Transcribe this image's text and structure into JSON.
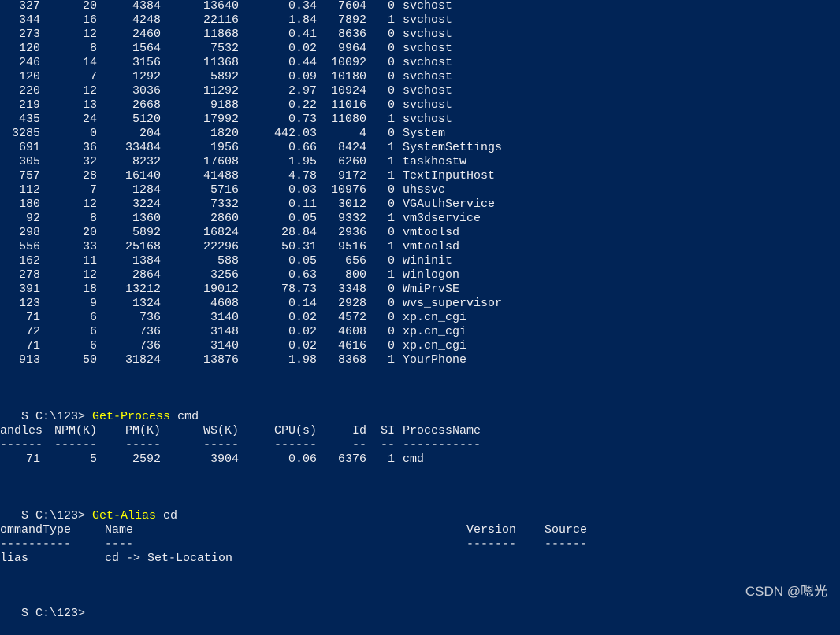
{
  "process_rows": [
    {
      "handles": "327",
      "npm": "20",
      "pm": "4384",
      "ws": "13640",
      "cpu": "0.34",
      "id": "7604",
      "si": "0",
      "name": "svchost"
    },
    {
      "handles": "344",
      "npm": "16",
      "pm": "4248",
      "ws": "22116",
      "cpu": "1.84",
      "id": "7892",
      "si": "1",
      "name": "svchost"
    },
    {
      "handles": "273",
      "npm": "12",
      "pm": "2460",
      "ws": "11868",
      "cpu": "0.41",
      "id": "8636",
      "si": "0",
      "name": "svchost"
    },
    {
      "handles": "120",
      "npm": "8",
      "pm": "1564",
      "ws": "7532",
      "cpu": "0.02",
      "id": "9964",
      "si": "0",
      "name": "svchost"
    },
    {
      "handles": "246",
      "npm": "14",
      "pm": "3156",
      "ws": "11368",
      "cpu": "0.44",
      "id": "10092",
      "si": "0",
      "name": "svchost"
    },
    {
      "handles": "120",
      "npm": "7",
      "pm": "1292",
      "ws": "5892",
      "cpu": "0.09",
      "id": "10180",
      "si": "0",
      "name": "svchost"
    },
    {
      "handles": "220",
      "npm": "12",
      "pm": "3036",
      "ws": "11292",
      "cpu": "2.97",
      "id": "10924",
      "si": "0",
      "name": "svchost"
    },
    {
      "handles": "219",
      "npm": "13",
      "pm": "2668",
      "ws": "9188",
      "cpu": "0.22",
      "id": "11016",
      "si": "0",
      "name": "svchost"
    },
    {
      "handles": "435",
      "npm": "24",
      "pm": "5120",
      "ws": "17992",
      "cpu": "0.73",
      "id": "11080",
      "si": "1",
      "name": "svchost"
    },
    {
      "handles": "3285",
      "npm": "0",
      "pm": "204",
      "ws": "1820",
      "cpu": "442.03",
      "id": "4",
      "si": "0",
      "name": "System"
    },
    {
      "handles": "691",
      "npm": "36",
      "pm": "33484",
      "ws": "1956",
      "cpu": "0.66",
      "id": "8424",
      "si": "1",
      "name": "SystemSettings"
    },
    {
      "handles": "305",
      "npm": "32",
      "pm": "8232",
      "ws": "17608",
      "cpu": "1.95",
      "id": "6260",
      "si": "1",
      "name": "taskhostw"
    },
    {
      "handles": "757",
      "npm": "28",
      "pm": "16140",
      "ws": "41488",
      "cpu": "4.78",
      "id": "9172",
      "si": "1",
      "name": "TextInputHost"
    },
    {
      "handles": "112",
      "npm": "7",
      "pm": "1284",
      "ws": "5716",
      "cpu": "0.03",
      "id": "10976",
      "si": "0",
      "name": "uhssvc"
    },
    {
      "handles": "180",
      "npm": "12",
      "pm": "3224",
      "ws": "7332",
      "cpu": "0.11",
      "id": "3012",
      "si": "0",
      "name": "VGAuthService"
    },
    {
      "handles": "92",
      "npm": "8",
      "pm": "1360",
      "ws": "2860",
      "cpu": "0.05",
      "id": "9332",
      "si": "1",
      "name": "vm3dservice"
    },
    {
      "handles": "298",
      "npm": "20",
      "pm": "5892",
      "ws": "16824",
      "cpu": "28.84",
      "id": "2936",
      "si": "0",
      "name": "vmtoolsd"
    },
    {
      "handles": "556",
      "npm": "33",
      "pm": "25168",
      "ws": "22296",
      "cpu": "50.31",
      "id": "9516",
      "si": "1",
      "name": "vmtoolsd"
    },
    {
      "handles": "162",
      "npm": "11",
      "pm": "1384",
      "ws": "588",
      "cpu": "0.05",
      "id": "656",
      "si": "0",
      "name": "wininit"
    },
    {
      "handles": "278",
      "npm": "12",
      "pm": "2864",
      "ws": "3256",
      "cpu": "0.63",
      "id": "800",
      "si": "1",
      "name": "winlogon"
    },
    {
      "handles": "391",
      "npm": "18",
      "pm": "13212",
      "ws": "19012",
      "cpu": "78.73",
      "id": "3348",
      "si": "0",
      "name": "WmiPrvSE"
    },
    {
      "handles": "123",
      "npm": "9",
      "pm": "1324",
      "ws": "4608",
      "cpu": "0.14",
      "id": "2928",
      "si": "0",
      "name": "wvs_supervisor"
    },
    {
      "handles": "71",
      "npm": "6",
      "pm": "736",
      "ws": "3140",
      "cpu": "0.02",
      "id": "4572",
      "si": "0",
      "name": "xp.cn_cgi"
    },
    {
      "handles": "72",
      "npm": "6",
      "pm": "736",
      "ws": "3148",
      "cpu": "0.02",
      "id": "4608",
      "si": "0",
      "name": "xp.cn_cgi"
    },
    {
      "handles": "71",
      "npm": "6",
      "pm": "736",
      "ws": "3140",
      "cpu": "0.02",
      "id": "4616",
      "si": "0",
      "name": "xp.cn_cgi"
    },
    {
      "handles": "913",
      "npm": "50",
      "pm": "31824",
      "ws": "13876",
      "cpu": "1.98",
      "id": "8368",
      "si": "1",
      "name": "YourPhone"
    }
  ],
  "prompt1": {
    "prefix": "S C:\\123> ",
    "command": "Get-Process",
    "args": " cmd"
  },
  "proc_header": {
    "handles": "andles",
    "npm": "NPM(K)",
    "pm": "PM(K)",
    "ws": "WS(K)",
    "cpu": "CPU(s)",
    "id": "Id",
    "si": "SI",
    "name": "ProcessName"
  },
  "proc_divider": {
    "handles": "------",
    "npm": "------",
    "pm": "-----",
    "ws": "-----",
    "cpu": "------",
    "id": "--",
    "si": "--",
    "name": "-----------"
  },
  "cmd_row": {
    "handles": "71",
    "npm": "5",
    "pm": "2592",
    "ws": "3904",
    "cpu": "0.06",
    "id": "6376",
    "si": "1",
    "name": "cmd"
  },
  "prompt2": {
    "prefix": "S C:\\123> ",
    "command": "Get-Alias",
    "args": " cd"
  },
  "alias_header": {
    "type": "ommandType",
    "name": "Name",
    "version": "Version",
    "source": "Source"
  },
  "alias_divider": {
    "type": "----------",
    "name": "----",
    "version": "-------",
    "source": "------"
  },
  "alias_row": {
    "type": "lias",
    "name": "cd -> Set-Location",
    "version": "",
    "source": ""
  },
  "prompt3": {
    "prefix": "S C:\\123>"
  },
  "watermark": "CSDN @嗯光",
  "colors": {
    "background": "#012456",
    "text": "#eeedf0",
    "command": "#ffff00"
  }
}
